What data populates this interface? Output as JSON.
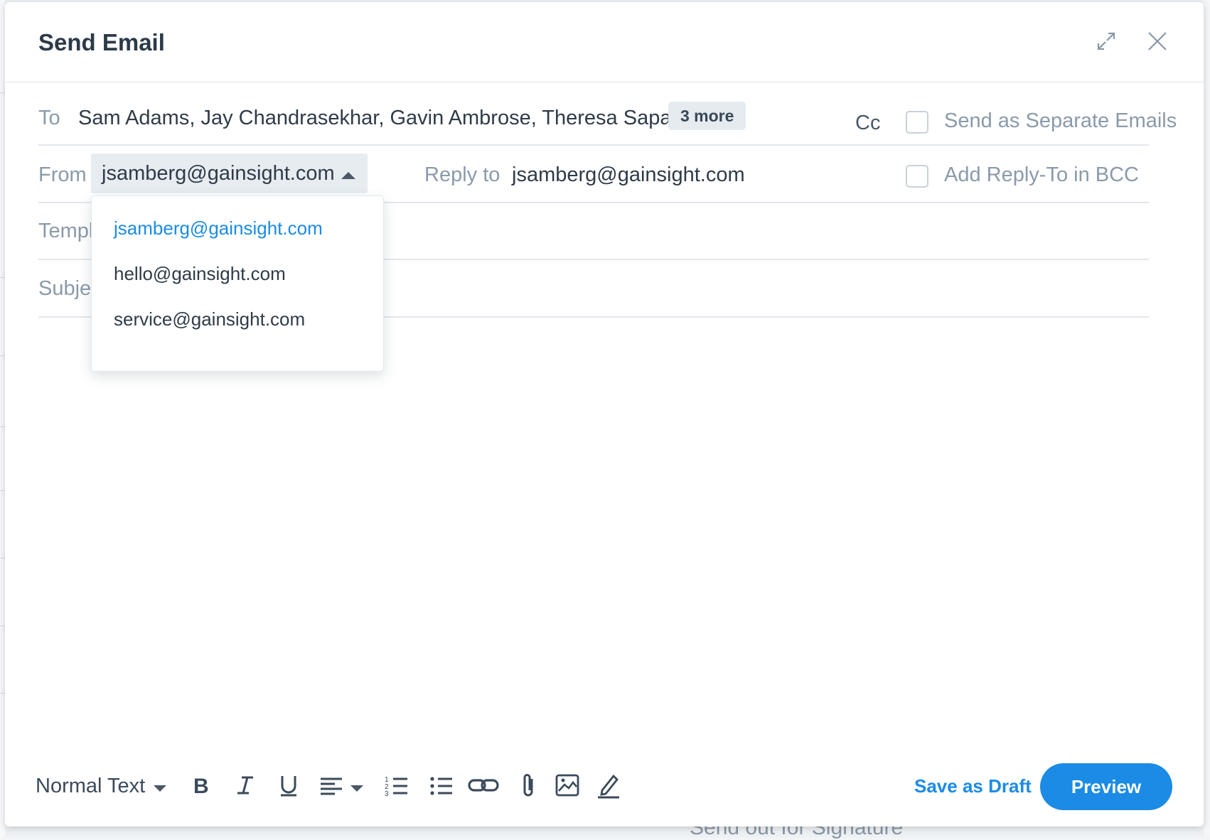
{
  "window": {
    "title": "Send Email"
  },
  "to": {
    "label": "To",
    "recipients": "Sam Adams, Jay Chandrasekhar, Gavin Ambrose, Theresa Sapara",
    "more_chip": "3 more",
    "cc_label": "Cc",
    "separate_label": "Send as Separate Emails"
  },
  "from": {
    "label": "From",
    "selected": "jsamberg@gainsight.com",
    "options": [
      "jsamberg@gainsight.com",
      "hello@gainsight.com",
      "service@gainsight.com"
    ],
    "reply_to_label": "Reply to",
    "reply_to_value": "jsamberg@gainsight.com",
    "bcc_label": "Add Reply-To in BCC"
  },
  "template": {
    "label": "Templ"
  },
  "subject": {
    "label": "Subje"
  },
  "toolbar": {
    "text_style": "Normal Text",
    "icons": [
      "bold-icon",
      "italic-icon",
      "underline-icon",
      "align-icon",
      "numbered-list-icon",
      "bulleted-list-icon",
      "link-icon",
      "attachment-icon",
      "image-icon",
      "signature-icon"
    ]
  },
  "actions": {
    "save_draft": "Save as Draft",
    "preview": "Preview"
  },
  "background": {
    "partial_text": "Send out for Signature"
  },
  "colors": {
    "accent": "#1b8be5",
    "text": "#2f3b48",
    "muted": "#8a9aaa"
  }
}
